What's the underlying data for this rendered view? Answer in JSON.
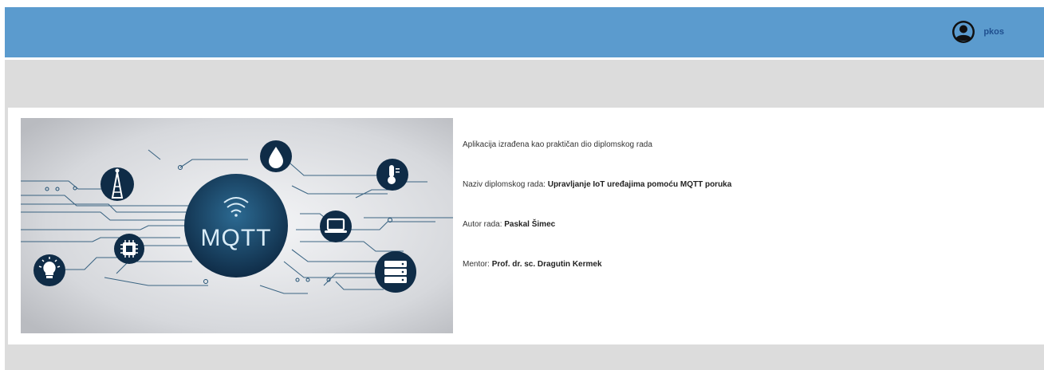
{
  "header": {
    "username": "pkos",
    "user_icon": "user-circle-icon",
    "accent_color": "#5b9bce"
  },
  "hero": {
    "logo_text": "MQTT",
    "icons": [
      "water-drop-icon",
      "thermometer-icon",
      "antenna-tower-icon",
      "laptop-icon",
      "chip-icon",
      "lightbulb-icon",
      "server-icon",
      "wifi-icon"
    ]
  },
  "info": {
    "intro": "Aplikacija izrađena kao praktičan dio diplomskog rada",
    "thesis_label": "Naziv diplomskog rada:",
    "thesis_value": "Upravljanje IoT uređajima pomoću MQTT poruka",
    "author_label": "Autor rada:",
    "author_value": "Paskal Šimec",
    "mentor_label": "Mentor:",
    "mentor_value": "Prof. dr. sc. Dragutin Kermek"
  }
}
